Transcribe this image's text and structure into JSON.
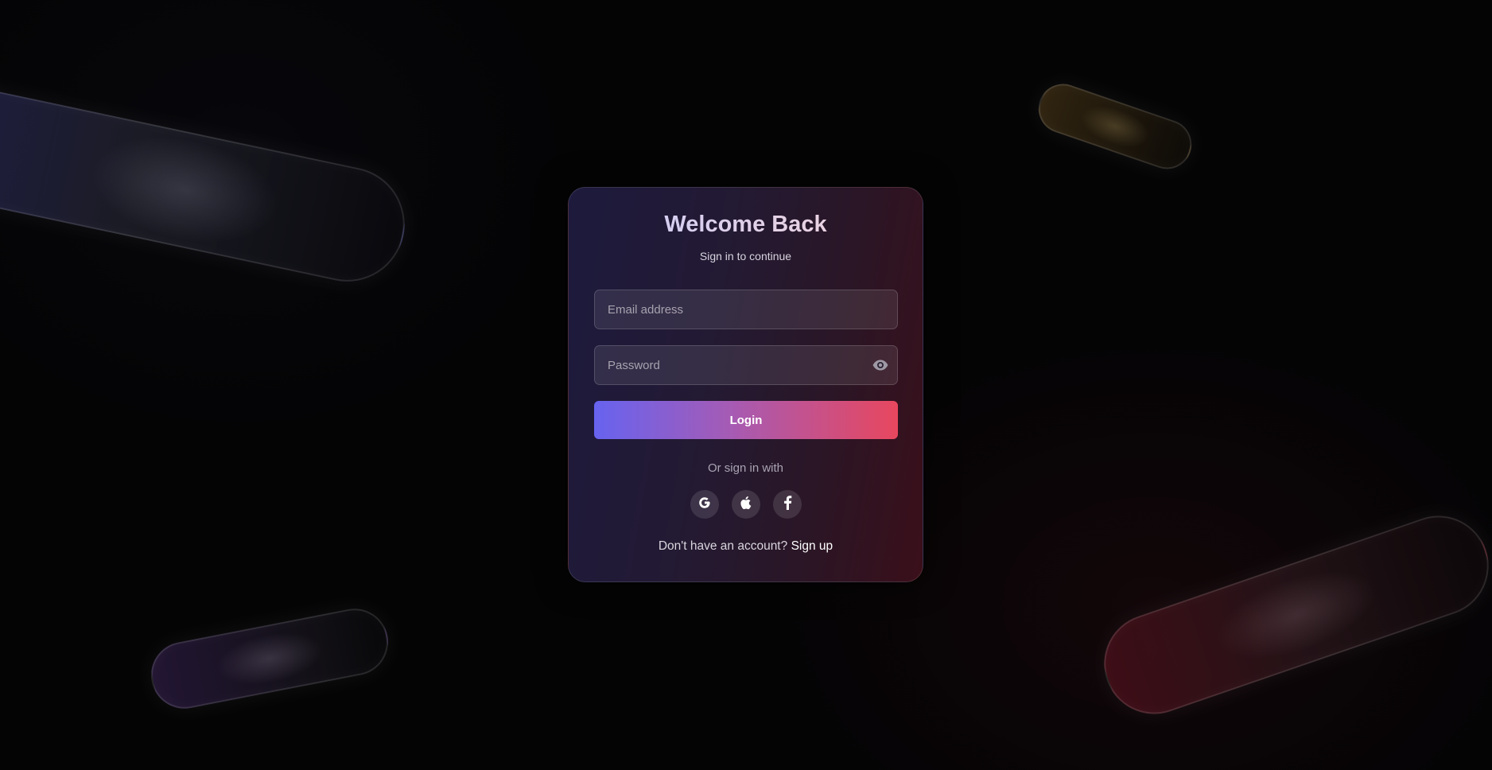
{
  "login_card": {
    "title": "Welcome Back",
    "subtitle": "Sign in to continue",
    "email": {
      "placeholder": "Email address",
      "value": ""
    },
    "password": {
      "placeholder": "Password",
      "value": "",
      "toggle_icon": "eye-icon"
    },
    "login_label": "Login",
    "divider_text": "Or sign in with",
    "social_providers": [
      {
        "name": "google",
        "icon": "google-icon"
      },
      {
        "name": "apple",
        "icon": "apple-icon"
      },
      {
        "name": "facebook",
        "icon": "facebook-icon"
      }
    ],
    "footer_text": "Don't have an account?",
    "signup_label": "Sign up"
  },
  "colors": {
    "page_background": "#040405",
    "button_gradient_start": "#6763f0",
    "button_gradient_end": "#e8475e",
    "card_gradient_start": "#1d1a3d",
    "card_gradient_end": "#3a0f1a"
  }
}
